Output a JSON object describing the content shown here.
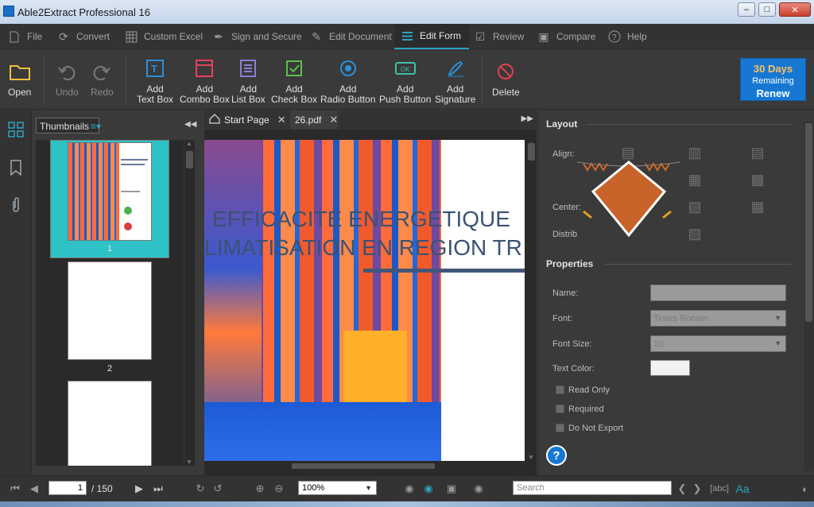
{
  "window": {
    "title": "Able2Extract Professional 16"
  },
  "menu": [
    {
      "label": "File",
      "icon": "file-icon"
    },
    {
      "label": "Convert",
      "icon": "convert-icon"
    },
    {
      "label": "Custom Excel",
      "icon": "grid-icon"
    },
    {
      "label": "Sign and Secure",
      "icon": "pen-icon"
    },
    {
      "label": "Edit Document",
      "icon": "edit-icon"
    },
    {
      "label": "Edit Form",
      "icon": "form-icon",
      "active": true
    },
    {
      "label": "Review",
      "icon": "review-icon"
    },
    {
      "label": "Compare",
      "icon": "compare-icon"
    },
    {
      "label": "Help",
      "icon": "help-icon"
    }
  ],
  "ribbon": {
    "open": "Open",
    "undo": "Undo",
    "redo": "Redo",
    "add_text_box": [
      "Add",
      "Text Box"
    ],
    "add_combo_box": [
      "Add",
      "Combo Box"
    ],
    "add_list_box": [
      "Add",
      "List Box"
    ],
    "add_check_box": [
      "Add",
      "Check Box"
    ],
    "add_radio_button": [
      "Add",
      "Radio Button"
    ],
    "add_push_button": [
      "Add",
      "Push Button"
    ],
    "add_signature": [
      "Add",
      "Signature"
    ],
    "delete": "Delete"
  },
  "trial": {
    "days": "30 Days",
    "remaining": "Remaining",
    "renew": "Renew"
  },
  "thumbnails": {
    "selector_label": "Thumbnails",
    "pages": [
      "1",
      "2"
    ]
  },
  "doc_tabs": [
    {
      "label": "Start Page",
      "icon": "home-icon"
    },
    {
      "label": "26.pdf",
      "active": true
    }
  ],
  "document": {
    "line1": "EFFICACITE ENERGETIQUE",
    "line2": "LIMATISATION EN REGION TR"
  },
  "properties_panel": {
    "layout_heading": "Layout",
    "align_label": "Align:",
    "center_label": "Center:",
    "distribute_label": "Distrib",
    "properties_heading": "Properties",
    "name_label": "Name:",
    "name_value": "",
    "font_label": "Font:",
    "font_value": "Times-Roman",
    "font_size_label": "Font Size:",
    "font_size_value": "10",
    "text_color_label": "Text Color:",
    "read_only": "Read Only",
    "required": "Required",
    "do_not_export": "Do Not Export",
    "help": "?"
  },
  "status": {
    "page_current": "1",
    "page_total": "/ 150",
    "zoom": "100%",
    "search_placeholder": "Search"
  },
  "colors": {
    "accent": "#2aa4c4",
    "trial_bg": "#1778d3",
    "trial_days": "#ffc15a",
    "thumb_selected": "#2ec2c6"
  }
}
